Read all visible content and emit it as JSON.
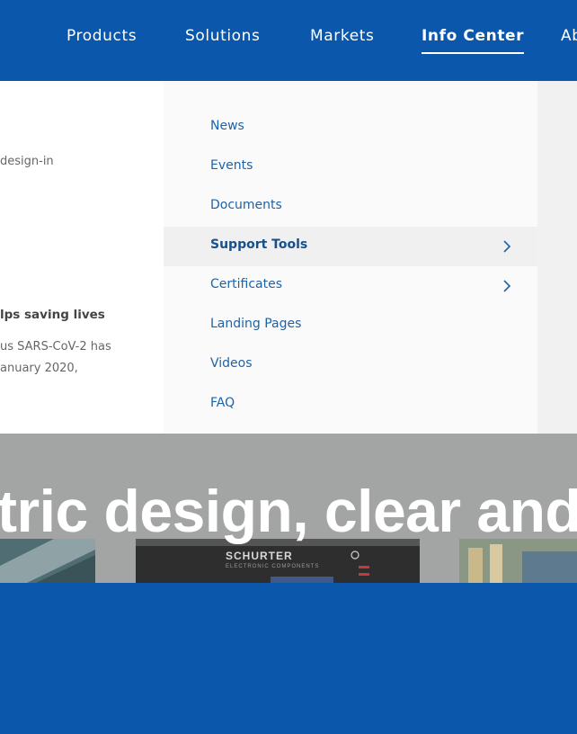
{
  "nav": {
    "items": [
      {
        "label": "Products"
      },
      {
        "label": "Solutions"
      },
      {
        "label": "Markets"
      },
      {
        "label": "Info Center",
        "active": true
      },
      {
        "label": "Ab"
      }
    ]
  },
  "left_panel": {
    "snippet1": "design-in",
    "article_title": "lps saving lives",
    "article_line1": "us SARS-CoV-2 has",
    "article_line2": "anuary 2020,"
  },
  "dropdown": {
    "items": [
      {
        "label": "News",
        "has_submenu": false
      },
      {
        "label": "Events",
        "has_submenu": false
      },
      {
        "label": "Documents",
        "has_submenu": false
      },
      {
        "label": "Support Tools",
        "has_submenu": true,
        "hovered": true
      },
      {
        "label": "Certificates",
        "has_submenu": true
      },
      {
        "label": "Landing Pages",
        "has_submenu": false
      },
      {
        "label": "Videos",
        "has_submenu": false
      },
      {
        "label": "FAQ",
        "has_submenu": false
      }
    ]
  },
  "hero": {
    "headline": "tric design, clear and",
    "product_logo": "SCHURTER",
    "product_logo_sub": "ELECTRONIC COMPONENTS"
  },
  "colors": {
    "brand_blue": "#0a57ac",
    "link_blue": "#1e63a8",
    "hero_gray": "#a3a5a5"
  }
}
